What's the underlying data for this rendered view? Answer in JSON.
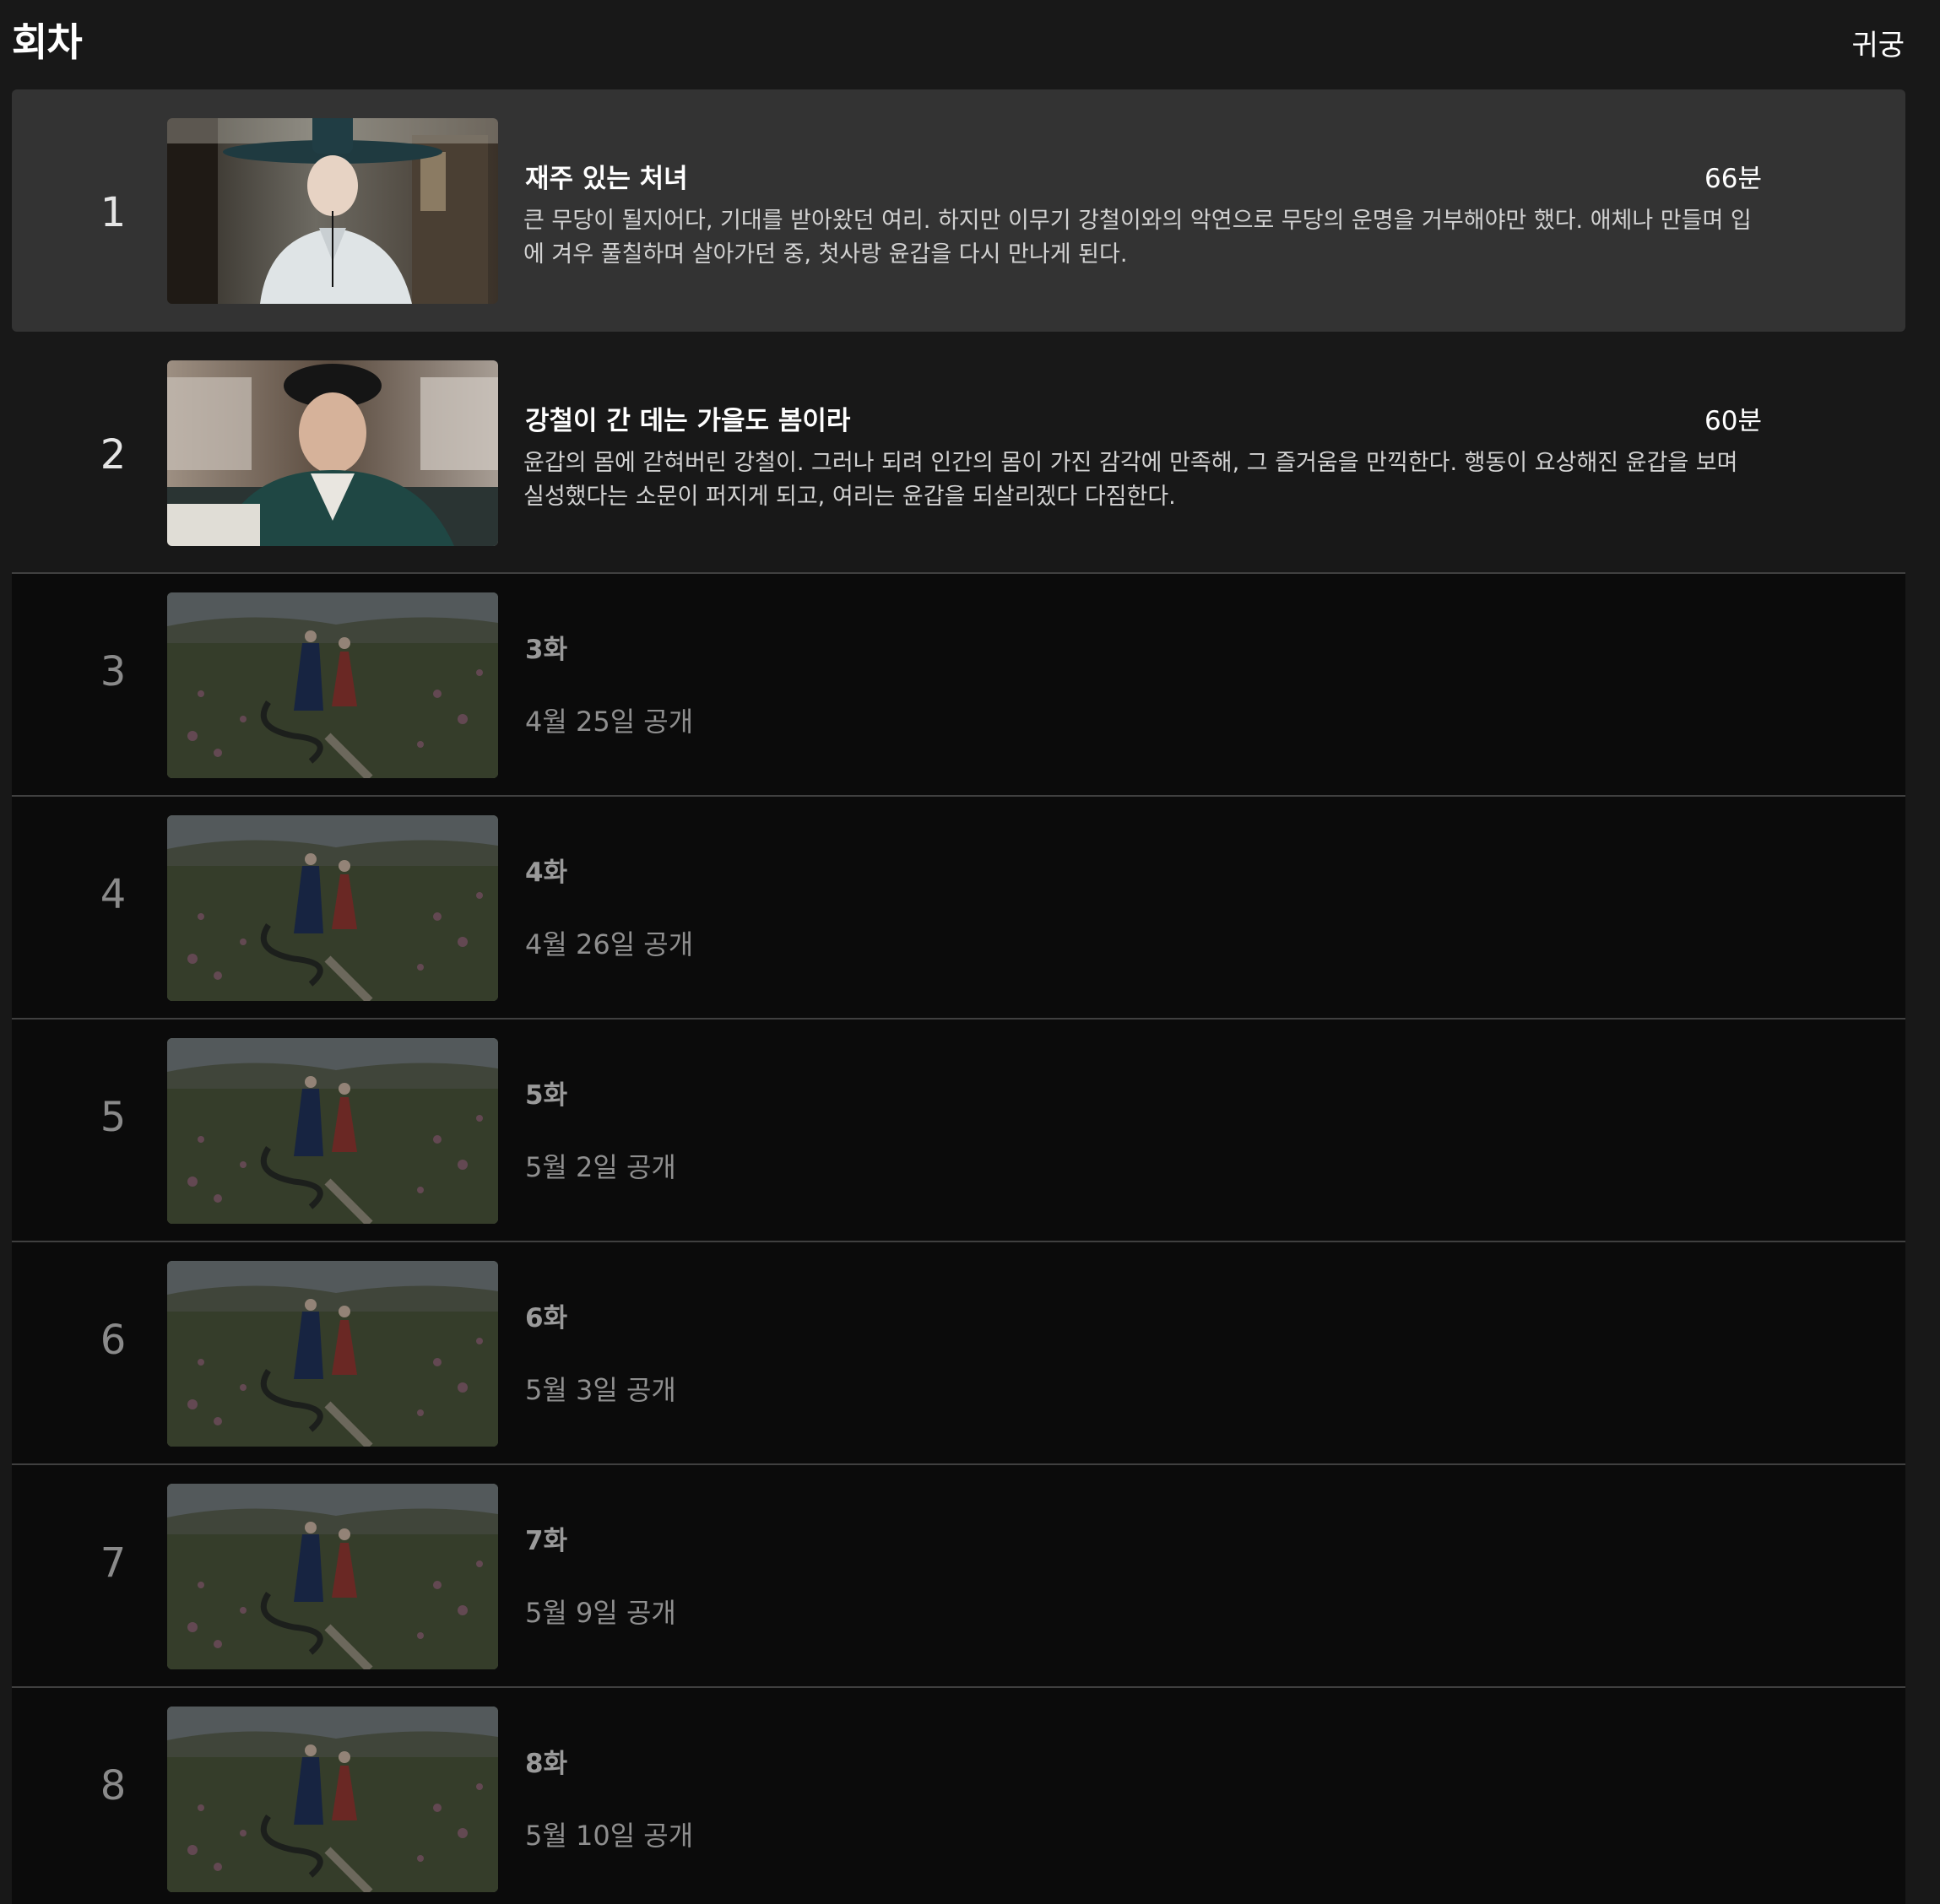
{
  "header": {
    "title": "회차",
    "show_label": "귀궁"
  },
  "episodes": [
    {
      "number": "1",
      "title": "재주 있는 처녀",
      "duration": "66분",
      "description": "큰 무당이 될지어다, 기대를 받아왔던 여리. 하지만 이무기 강철이와의 악연으로 무당의 운명을 거부해야만 했다. 애체나 만들며 입에 겨우 풀칠하며 살아가던 중, 첫사랑 윤갑을 다시 만나게 된다."
    },
    {
      "number": "2",
      "title": "강철이 간 데는 가을도 봄이라",
      "duration": "60분",
      "description": "윤갑의 몸에 갇혀버린 강철이. 그러나 되려 인간의 몸이 가진 감각에 만족해, 그 즐거움을 만끽한다. 행동이 요상해진 윤갑을 보며 실성했다는 소문이 퍼지게 되고, 여리는 윤갑을 되살리겠다 다짐한다."
    },
    {
      "number": "3",
      "title": "3화",
      "release": "4월 25일 공개"
    },
    {
      "number": "4",
      "title": "4화",
      "release": "4월 26일 공개"
    },
    {
      "number": "5",
      "title": "5화",
      "release": "5월 2일 공개"
    },
    {
      "number": "6",
      "title": "6화",
      "release": "5월 3일 공개"
    },
    {
      "number": "7",
      "title": "7화",
      "release": "5월 9일 공개"
    },
    {
      "number": "8",
      "title": "8화",
      "release": "5월 10일 공개"
    }
  ],
  "colors": {
    "background": "#181818",
    "selected_row": "#333333",
    "upcoming_row": "#0b0b0b",
    "divider": "#404040"
  }
}
